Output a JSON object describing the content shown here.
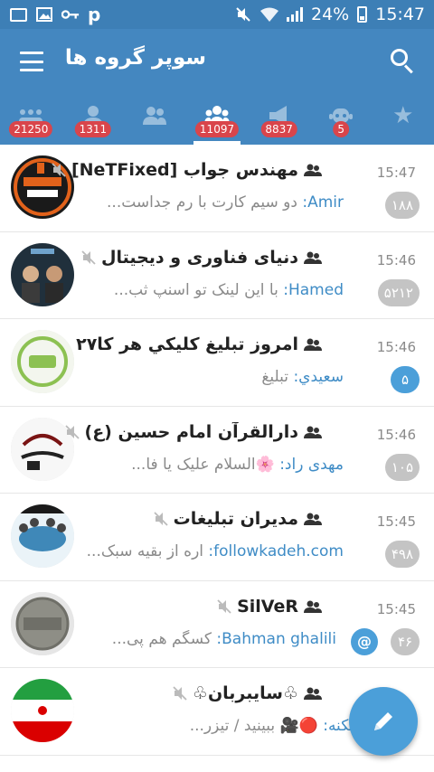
{
  "status_bar": {
    "battery": "24%",
    "time": "15:47",
    "left_icons": [
      "screenshot-icon",
      "image-icon",
      "key-icon",
      "p-icon"
    ],
    "right_icons": [
      "mute-icon",
      "wifi-icon",
      "signal-icon",
      "battery-icon"
    ]
  },
  "toolbar": {
    "title": "سوپر گروه ها",
    "menu_icon": "hamburger-menu-icon",
    "search_icon": "search-icon"
  },
  "tabs": [
    {
      "icon": "all-chats-icon",
      "badge": "21250",
      "active": false
    },
    {
      "icon": "user-icon",
      "badge": "1311",
      "active": false
    },
    {
      "icon": "group-icon",
      "badge": "",
      "active": false
    },
    {
      "icon": "supergroup-icon",
      "badge": "11097",
      "active": true
    },
    {
      "icon": "channel-icon",
      "badge": "8837",
      "active": false
    },
    {
      "icon": "bot-icon",
      "badge": "5",
      "active": false
    },
    {
      "icon": "star-icon",
      "badge": "",
      "active": false
    }
  ],
  "chats": [
    {
      "title": "مهندس جواب [NeTFixed]",
      "muted": true,
      "time": "15:47",
      "sender": "Amir:",
      "message": "دو سیم کارت با رم جداست...",
      "count": "۱۸۸",
      "count_muted": true,
      "mention": false
    },
    {
      "title": "دنیای فناوری و دیجیتال",
      "muted": true,
      "time": "15:46",
      "sender": "Hamed:",
      "message": "با این لینک تو اسنپ ثب...",
      "count": "۵۲۱۲",
      "count_muted": true,
      "mention": false
    },
    {
      "title": "امروز تبلیغ کلیکي هر کا۲۷",
      "muted": false,
      "time": "15:46",
      "sender": "سعيدي:",
      "message": "تبليغ",
      "count": "۵",
      "count_muted": false,
      "mention": false
    },
    {
      "title": "دارالقرآن امام حسین (ع)",
      "muted": true,
      "time": "15:46",
      "sender": "مهدی راد:",
      "message": "🌸السلام علیک یا فا...",
      "count": "۱۰۵",
      "count_muted": true,
      "mention": false
    },
    {
      "title": "مدیران تبلیغات",
      "muted": true,
      "time": "15:45",
      "sender": "followkadeh.com:",
      "message": "اره از بقیه سبک...",
      "count": "۴۹۸",
      "count_muted": true,
      "mention": false
    },
    {
      "title": "SilVeR",
      "muted": true,
      "time": "15:45",
      "sender": "Bahman ghalili:",
      "message": "کسگم هم پی...",
      "count": "۴۶",
      "count_muted": true,
      "mention": true,
      "mention_symbol": "@"
    },
    {
      "title": "♧سایبربان♧",
      "muted": true,
      "time": "",
      "sender": "حسین مسکنه:",
      "message": "🔴🎥 ببینید / تیزر...",
      "count": "",
      "count_muted": true,
      "mention": false
    }
  ],
  "fab": {
    "icon": "pencil-icon"
  },
  "colors": {
    "status_bar": "#3d7fb6",
    "toolbar": "#4487c0",
    "accent": "#4b9fd9",
    "tab_badge": "#d9454b",
    "muted_badge": "#c4c4c4",
    "sender_text": "#3f8cc6"
  }
}
